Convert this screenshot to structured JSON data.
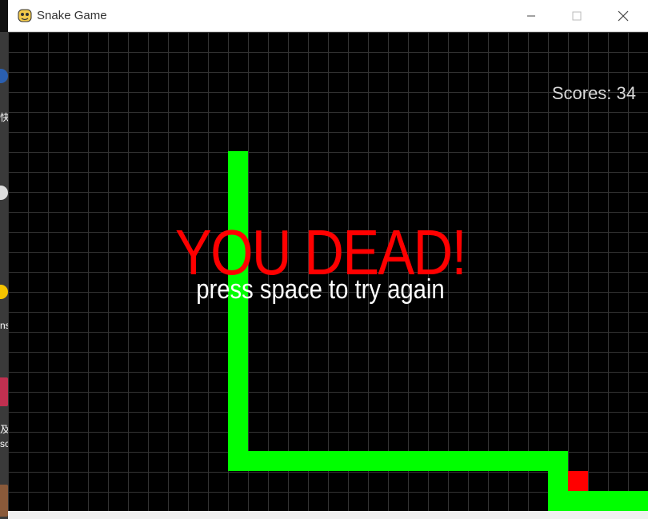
{
  "window": {
    "title": "Snake Game",
    "minimize_label": "—",
    "maximize_label": "☐",
    "close_label": "✕"
  },
  "game": {
    "score_text": "Scores: 34",
    "game_over_text": "YOU DEAD!",
    "retry_text": "press space to try again",
    "snake_color": "#00ff00",
    "food_color": "#ff0000",
    "grid_color": "#333333",
    "background_color": "#000000"
  },
  "desktop": {
    "labels": [
      "快",
      "ns",
      "及",
      "sc"
    ]
  }
}
